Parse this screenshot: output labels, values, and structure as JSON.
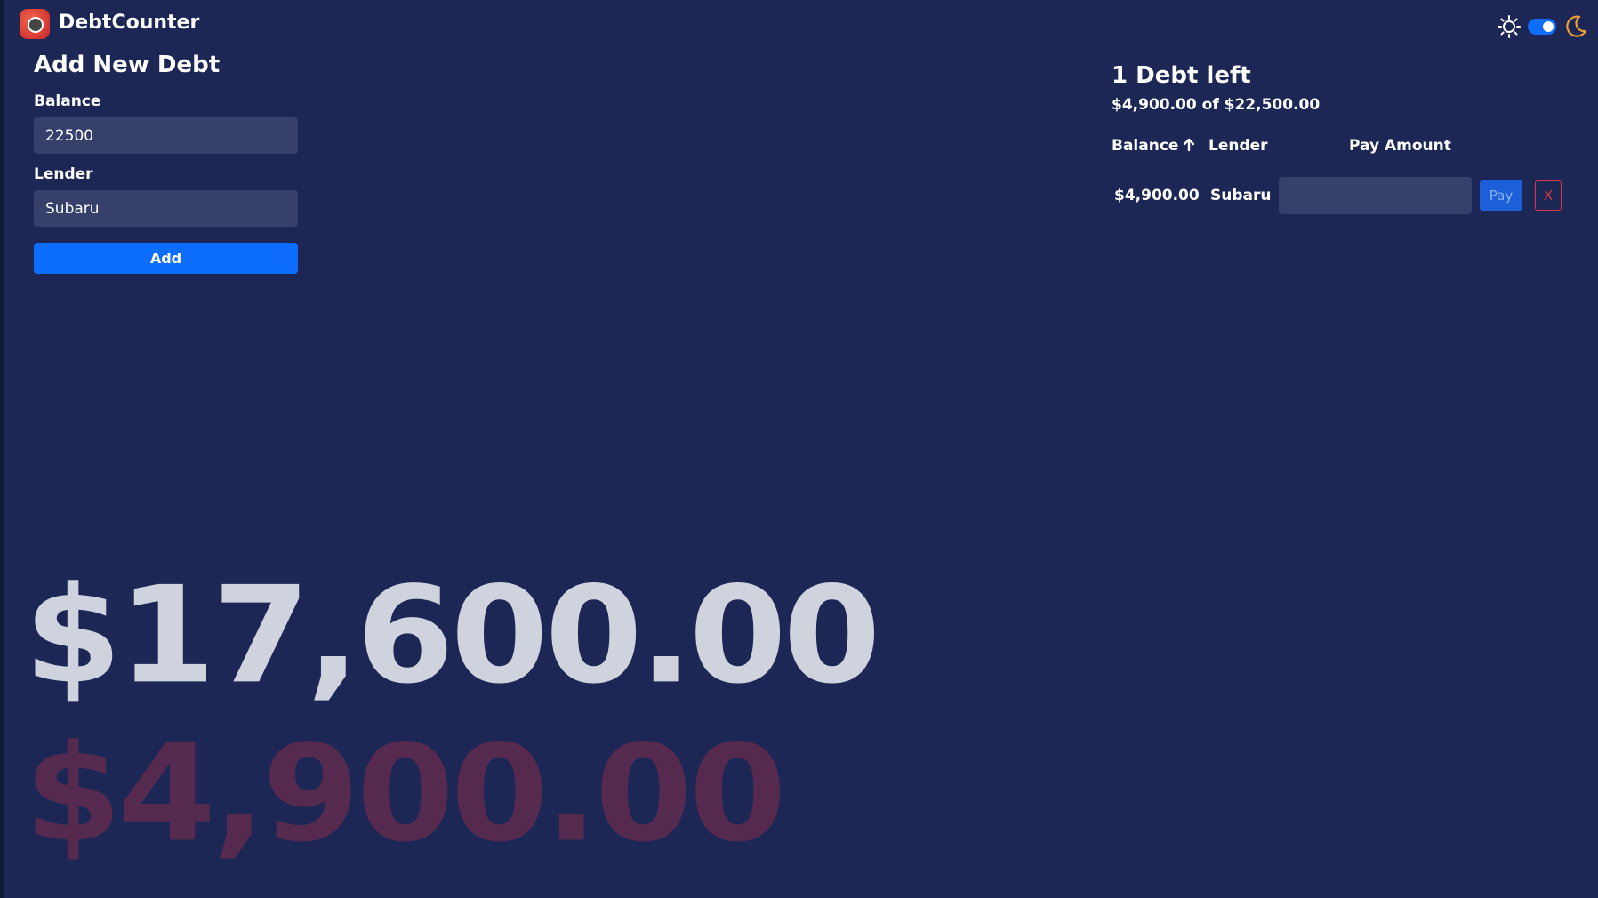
{
  "app": {
    "title": "DebtCounter",
    "theme": "dark",
    "accent_color": "#0d6efd",
    "background_color": "#1c2755"
  },
  "header": {
    "sun_icon": "sun-icon",
    "toggle_icon": "theme-toggle",
    "moon_icon": "moon-icon",
    "dark_mode_enabled": true
  },
  "form": {
    "title": "Add New Debt",
    "balance_label": "Balance",
    "balance_value": "22500",
    "lender_label": "Lender",
    "lender_value": "Subaru",
    "add_label": "Add"
  },
  "summary": {
    "debts_left": "1 Debt left",
    "progress_text": "$4,900.00 of $22,500.00",
    "columns": {
      "balance": "Balance",
      "lender": "Lender",
      "pay_amount": "Pay Amount"
    },
    "sort_icon": "arrow-up-icon",
    "rows": [
      {
        "balance": "$4,900.00",
        "lender": "Subaru",
        "pay_amount_value": "",
        "pay_label": "Pay",
        "delete_label": "X"
      }
    ]
  },
  "totals": {
    "big_remaining": "$17,600.00",
    "big_paid": "$4,900.00",
    "remaining_color": "#ced3de",
    "paid_color": "#562a4f"
  }
}
